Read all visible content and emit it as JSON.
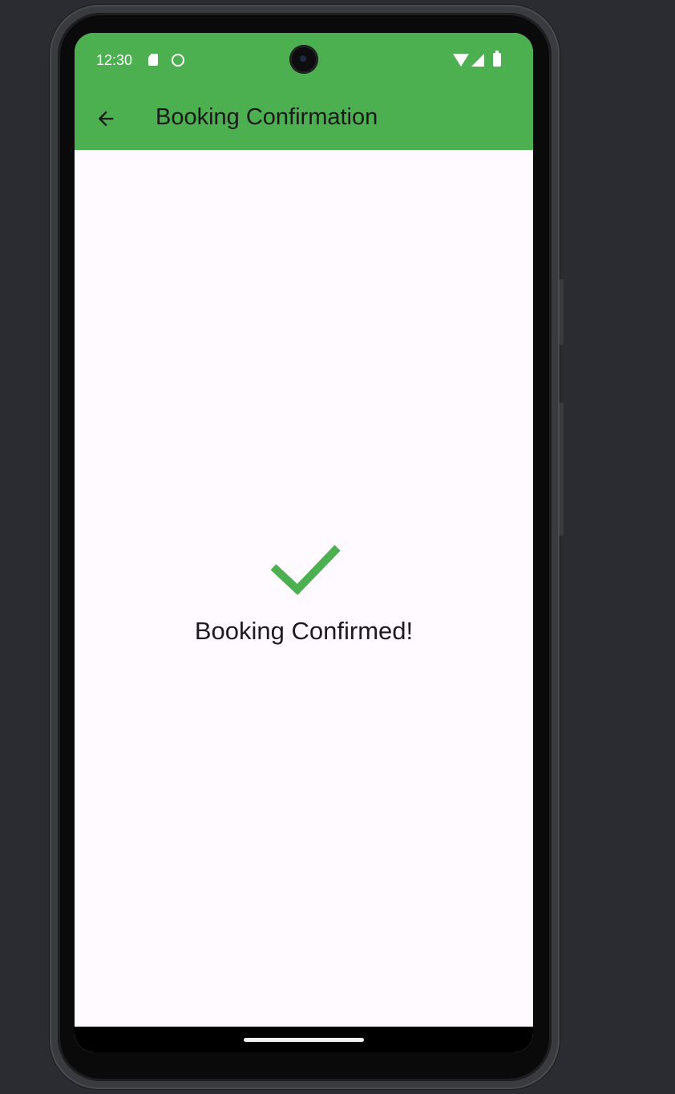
{
  "status_bar": {
    "time": "12:30",
    "icons": [
      "sd-card-icon",
      "face-icon",
      "wifi-icon",
      "signal-icon",
      "battery-icon"
    ]
  },
  "app_bar": {
    "back_icon": "arrow-back-icon",
    "title": "Booking Confirmation"
  },
  "main": {
    "icon": "check-icon",
    "message": "Booking Confirmed!"
  },
  "colors": {
    "primary": "#4caf50",
    "background": "#fefaff",
    "text": "#1c1b1f"
  }
}
